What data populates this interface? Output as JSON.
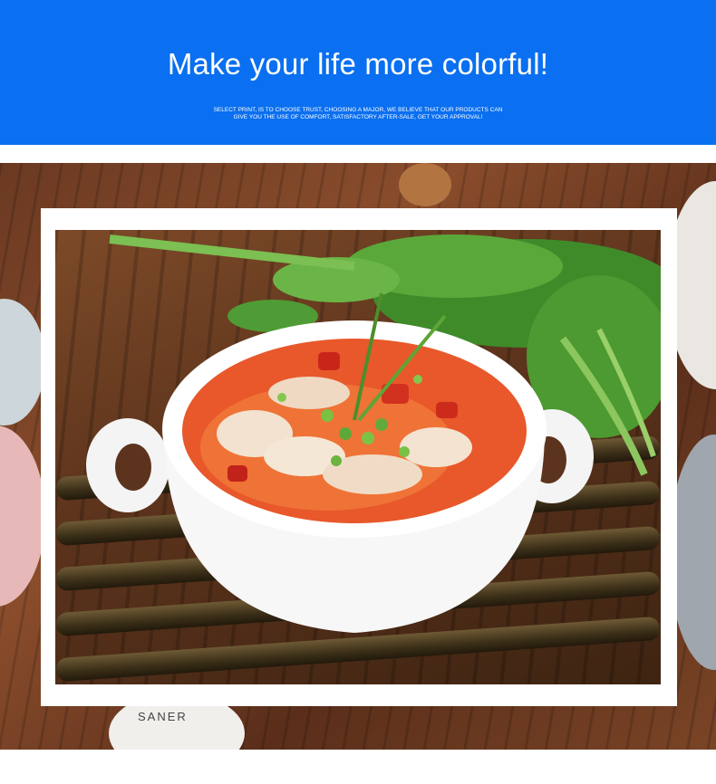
{
  "banner": {
    "title": "Make your life more colorful!",
    "subtitle_line1": "SELECT PRINT, IS TO CHOOSE TRUST, CHOOSING A MAJOR, WE BELIEVE THAT OUR PRODUCTS CAN",
    "subtitle_line2": "GIVE YOU THE USE OF COMFORT, SATISFACTORY AFTER-SALE, GET YOUR APPROVAL!",
    "background_color": "#0a6ff0"
  },
  "scene": {
    "plate_label": "SANER"
  }
}
